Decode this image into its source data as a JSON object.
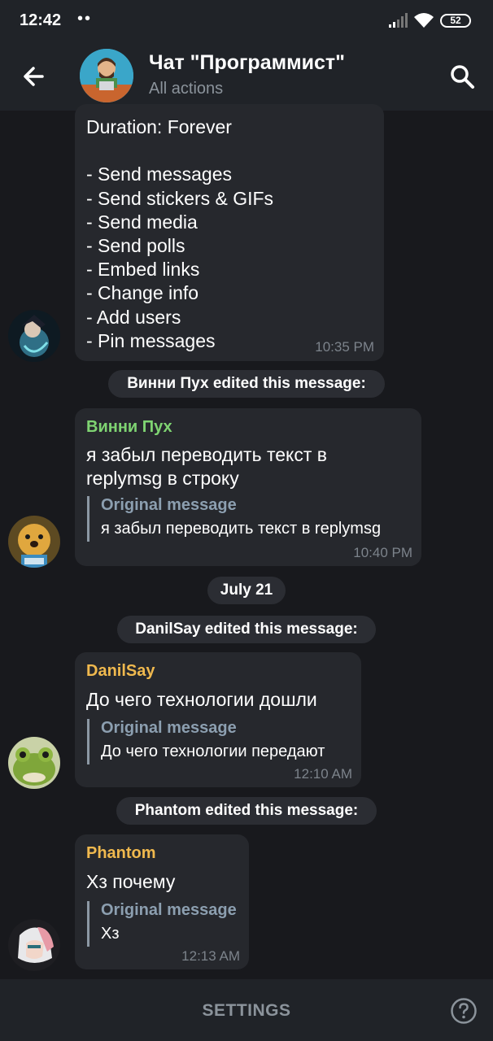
{
  "status_bar": {
    "time": "12:42",
    "dots": "••",
    "battery": "52"
  },
  "header": {
    "title": "Чат \"Программист\"",
    "subtitle": "All actions",
    "back_icon": "arrow-left-icon",
    "search_icon": "search-icon"
  },
  "messages": [
    {
      "text": "Duration: Forever\n\n- Send messages\n- Send stickers & GIFs\n- Send media\n- Send polls\n- Embed links\n- Change info\n- Add users\n- Pin messages",
      "time": "10:35 PM"
    },
    {
      "service": "Винни Пух edited this message:",
      "sender": "Винни Пух",
      "sender_color": "#7fd472",
      "text": "я забыл переводить текст в\nreplymsg в строку",
      "reply_title": "Original message",
      "reply_text": "я забыл переводить текст в replymsg",
      "time": "10:40 PM"
    },
    {
      "date": "July 21",
      "service": "DanilSay edited this message:",
      "sender": "DanilSay",
      "sender_color": "#f0b94e",
      "text": "До чего технологии дошли",
      "reply_title": "Original message",
      "reply_text": "До чего технологии передают",
      "time": "12:10 AM"
    },
    {
      "service": "Phantom edited this message:",
      "sender": "Phantom",
      "sender_color": "#f0b94e",
      "text": "Хз почему",
      "reply_title": "Original message",
      "reply_text": "Хз",
      "time": "12:13 AM"
    }
  ],
  "bottom_bar": {
    "settings_label": "SETTINGS",
    "help_icon": "question-circle-icon"
  }
}
